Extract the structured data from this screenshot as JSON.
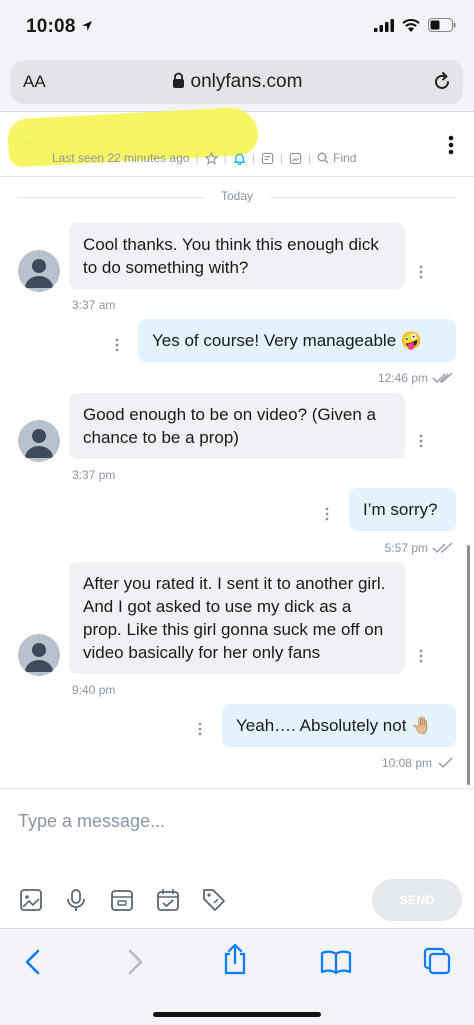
{
  "status": {
    "time": "10:08"
  },
  "browser": {
    "aa": "AA",
    "url": "onlyfans.com"
  },
  "chat": {
    "last_seen": "Last seen 22 minutes ago",
    "find_label": "Find",
    "date_divider": "Today"
  },
  "messages": [
    {
      "direction": "in",
      "text": "Cool thanks. You think this enough dick to do something with?",
      "time": "3:37 am"
    },
    {
      "direction": "out",
      "text": "Yes of course! Very manageable 🤪",
      "time": "12:46 pm",
      "receipt": "read"
    },
    {
      "direction": "in",
      "text": "Good enough to be on video? (Given a chance to be a prop)",
      "time": "3:37 pm"
    },
    {
      "direction": "out",
      "text": "I’m sorry?",
      "time": "5:57 pm",
      "receipt": "read"
    },
    {
      "direction": "in",
      "text": "After you rated it. I sent it to another girl. And I got asked to use my dick as a prop. Like this girl gonna suck me off on video basically for her only fans",
      "time": "9:40 pm"
    },
    {
      "direction": "out",
      "text": "Yeah…. Absolutely not 🤚🏼",
      "time": "10:08 pm",
      "receipt": "sent"
    }
  ],
  "composer": {
    "placeholder": "Type a message...",
    "send_label": "SEND"
  },
  "colors": {
    "accent": "#00aff0",
    "incoming_bubble": "#f0f1f5",
    "outgoing_bubble": "#e3f3fc",
    "ios_blue": "#0a7aff",
    "redaction": "#f4f55a"
  }
}
